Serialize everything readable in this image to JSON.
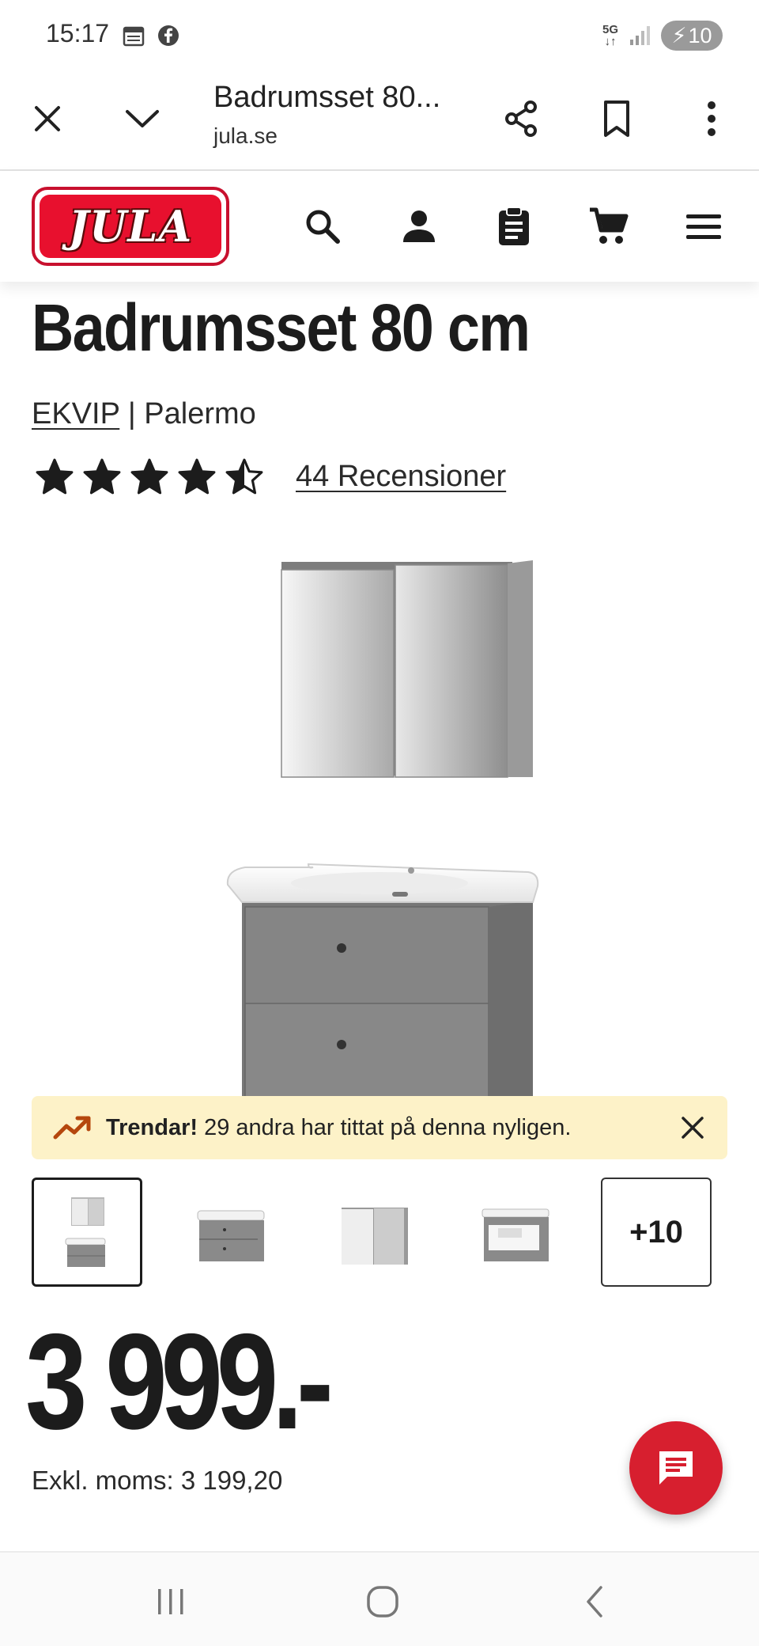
{
  "status_bar": {
    "time": "15:17",
    "network": "5G",
    "battery": "10",
    "icons": [
      "calendar-icon",
      "facebook-icon",
      "signal-icon",
      "battery-icon"
    ]
  },
  "browser": {
    "title": "Badrumsset 80...",
    "domain": "jula.se",
    "icons": [
      "close-icon",
      "chevron-down-icon",
      "share-icon",
      "bookmark-icon",
      "more-vert-icon"
    ]
  },
  "header": {
    "logo_text": "JULA",
    "brand_color": "#e8102e",
    "icons": [
      "search-icon",
      "account-icon",
      "shopping-list-icon",
      "cart-icon",
      "menu-icon"
    ]
  },
  "product": {
    "title": "Badrumsset 80 cm",
    "brand": "EKVIP",
    "separator": "|",
    "series": "Palermo",
    "rating": 4.5,
    "rating_max": 5,
    "reviews_label": "44 Recensioner"
  },
  "trend": {
    "bold": "Trendar!",
    "text": " 29 andra har tittat på denna nyligen.",
    "accent": "#b5470d",
    "background": "#fdf2c8"
  },
  "thumbnails": {
    "more_label": "+10"
  },
  "price": {
    "amount": "3 999.-",
    "vat_label": "Exkl. moms: 3 199,20"
  },
  "chat": {
    "color": "#d71f2f"
  },
  "nav": {
    "icons": [
      "recents-icon",
      "home-icon",
      "back-icon"
    ]
  }
}
